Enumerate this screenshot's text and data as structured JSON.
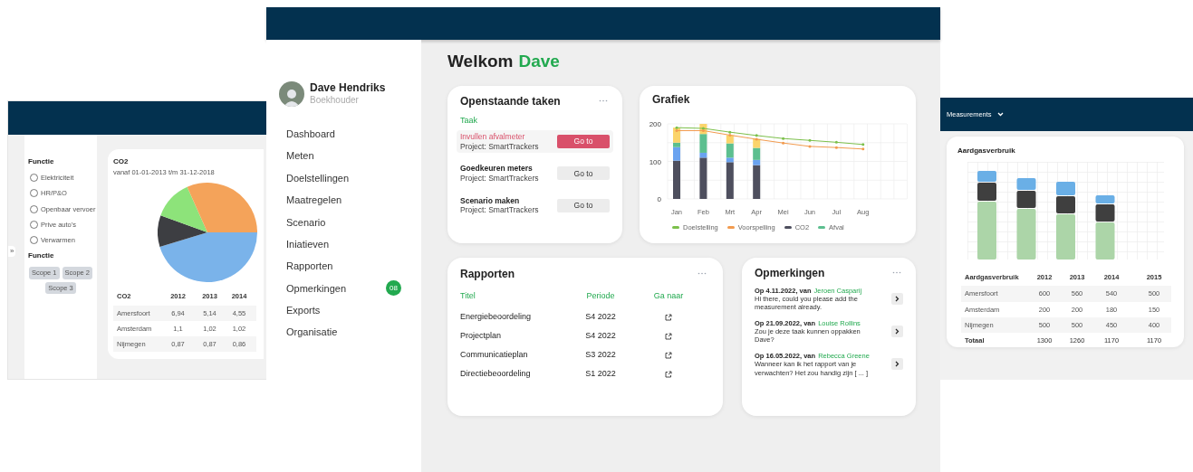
{
  "left_window": {
    "expand_tab": "»",
    "filters": [
      {
        "title": "Functie",
        "kind": "radios",
        "options": [
          {
            "label": "Elektriciteit",
            "checked": false
          },
          {
            "label": "HR/P&O",
            "checked": false
          },
          {
            "label": "Openbaar vervoer",
            "checked": false
          },
          {
            "label": "Prive auto's",
            "checked": false
          },
          {
            "label": "Verwarmen",
            "checked": false
          }
        ]
      },
      {
        "title": "Functie",
        "kind": "chips",
        "chips": [
          "Scope 1",
          "Scope 2",
          "Scope 3"
        ]
      }
    ],
    "card": {
      "title": "CO2",
      "subtitle": "vanaf 01-01-2013 t/m 31-12-2018",
      "table": {
        "columns": [
          "CO2",
          "2012",
          "2013",
          "2014"
        ],
        "rows": [
          {
            "kind": "data",
            "cells": [
              "Amersfoort",
              "6,94",
              "5,14",
              "4,55"
            ]
          },
          {
            "kind": "data",
            "cells": [
              "Amsterdam",
              "1,1",
              "1,02",
              "1,02"
            ]
          },
          {
            "kind": "data",
            "cells": [
              "Nijmegen",
              "0,87",
              "0,87",
              "0,86"
            ]
          }
        ]
      }
    }
  },
  "main_window": {
    "user": {
      "name": "Dave Hendriks",
      "role": "Boekhouder"
    },
    "sidebar": {
      "items": [
        {
          "label": "Dashboard"
        },
        {
          "label": "Meten"
        },
        {
          "label": "Doelstellingen"
        },
        {
          "label": "Maatregelen"
        },
        {
          "label": "Scenario"
        },
        {
          "label": "Iniatieven"
        },
        {
          "label": "Rapporten"
        },
        {
          "label": "Opmerkingen",
          "badge": "08"
        },
        {
          "label": "Exports"
        },
        {
          "label": "Organisatie"
        }
      ]
    },
    "greeting": "Welkom",
    "greeting_name": "Dave",
    "tasks": {
      "title": "Openstaande taken",
      "column": "Taak",
      "items": [
        {
          "name": "Invullen afvalmeter",
          "project": "Project: SmartTrackers",
          "button": "Go to",
          "overdue": true
        },
        {
          "name": "Goedkeuren meters",
          "project": "Project: SmartTrackers",
          "button": "Go to",
          "overdue": false
        },
        {
          "name": "Scenario maken",
          "project": "Project: SmartTrackers",
          "button": "Go to",
          "overdue": false
        }
      ]
    },
    "chart": {
      "title": "Grafiek",
      "chart_data": {
        "type": "bar",
        "stacked": true,
        "categories": [
          "Jan",
          "Feb",
          "Mrt",
          "Apr",
          "Mei",
          "Jun",
          "Jul",
          "Aug"
        ],
        "ylim": [
          0,
          200
        ],
        "yticks": [
          0,
          100,
          200
        ],
        "series": [
          {
            "name": "Doelstelling",
            "type": "line",
            "color": "#7cc04b",
            "values": [
              190,
              188,
              178,
              169,
              161,
              156,
              151,
              145
            ]
          },
          {
            "name": "Voorspelling",
            "type": "line",
            "color": "#f29b4f",
            "values": [
              182,
              182,
              170,
              159,
              149,
              140,
              137,
              133
            ]
          },
          {
            "name": "CO2",
            "type": "bar",
            "color": "#4e4f5e",
            "values": [
              102,
              110,
              98,
              90,
              null,
              null,
              null,
              null
            ]
          },
          {
            "type": "bar",
            "color": "#6aa3f0",
            "values": [
              36,
              13,
              12,
              14,
              null,
              null,
              null,
              null
            ]
          },
          {
            "name": "Afval",
            "type": "bar",
            "color": "#5cbf8f",
            "values": [
              12,
              50,
              38,
              32,
              null,
              null,
              null,
              null
            ]
          },
          {
            "type": "bar",
            "color": "#fbd46b",
            "values": [
              40,
              27,
              22,
              24,
              null,
              null,
              null,
              null
            ]
          }
        ]
      }
    },
    "reports": {
      "title": "Rapporten",
      "columns": [
        "Titel",
        "Periode",
        "Ga naar"
      ],
      "rows": [
        {
          "title": "Energiebeoordeling",
          "period": "S4 2022"
        },
        {
          "title": "Projectplan",
          "period": "S4 2022"
        },
        {
          "title": "Communicatieplan",
          "period": "S3 2022"
        },
        {
          "title": "Directiebeoordeling",
          "period": "S1 2022"
        }
      ]
    },
    "comments": {
      "title": "Opmerkingen",
      "items": [
        {
          "meta": "Op 4.11.2022, van",
          "author": "Jeroen Casparij",
          "text": "Hi there, could you please add the measurement already."
        },
        {
          "meta": "Op 21.09.2022, van",
          "author": "Louise Rollins",
          "text": "Zou je deze taak kunnen oppakken Dave?"
        },
        {
          "meta": "Op 16.05.2022, van",
          "author": "Rebecca Greene",
          "text": "Wanneer kan ik het rapport van je verwachten? Het zou handig zijn [ ... ]"
        }
      ]
    }
  },
  "right_window": {
    "menu": "Measurements",
    "card": {
      "title": "Aardgasverbruik",
      "table": {
        "columns": [
          "Aardgasverbruik",
          "2012",
          "2013",
          "2014",
          "2015"
        ],
        "rows": [
          {
            "kind": "data",
            "cells": [
              "Amersfoort",
              "600",
              "560",
              "540",
              "500"
            ]
          },
          {
            "kind": "data",
            "cells": [
              "Amsterdam",
              "200",
              "200",
              "180",
              "150"
            ]
          },
          {
            "kind": "data",
            "cells": [
              "Nijmegen",
              "500",
              "500",
              "450",
              "400"
            ]
          },
          {
            "kind": "total",
            "cells": [
              "Totaal",
              "1300",
              "1260",
              "1170",
              "1170"
            ]
          }
        ]
      }
    }
  }
}
